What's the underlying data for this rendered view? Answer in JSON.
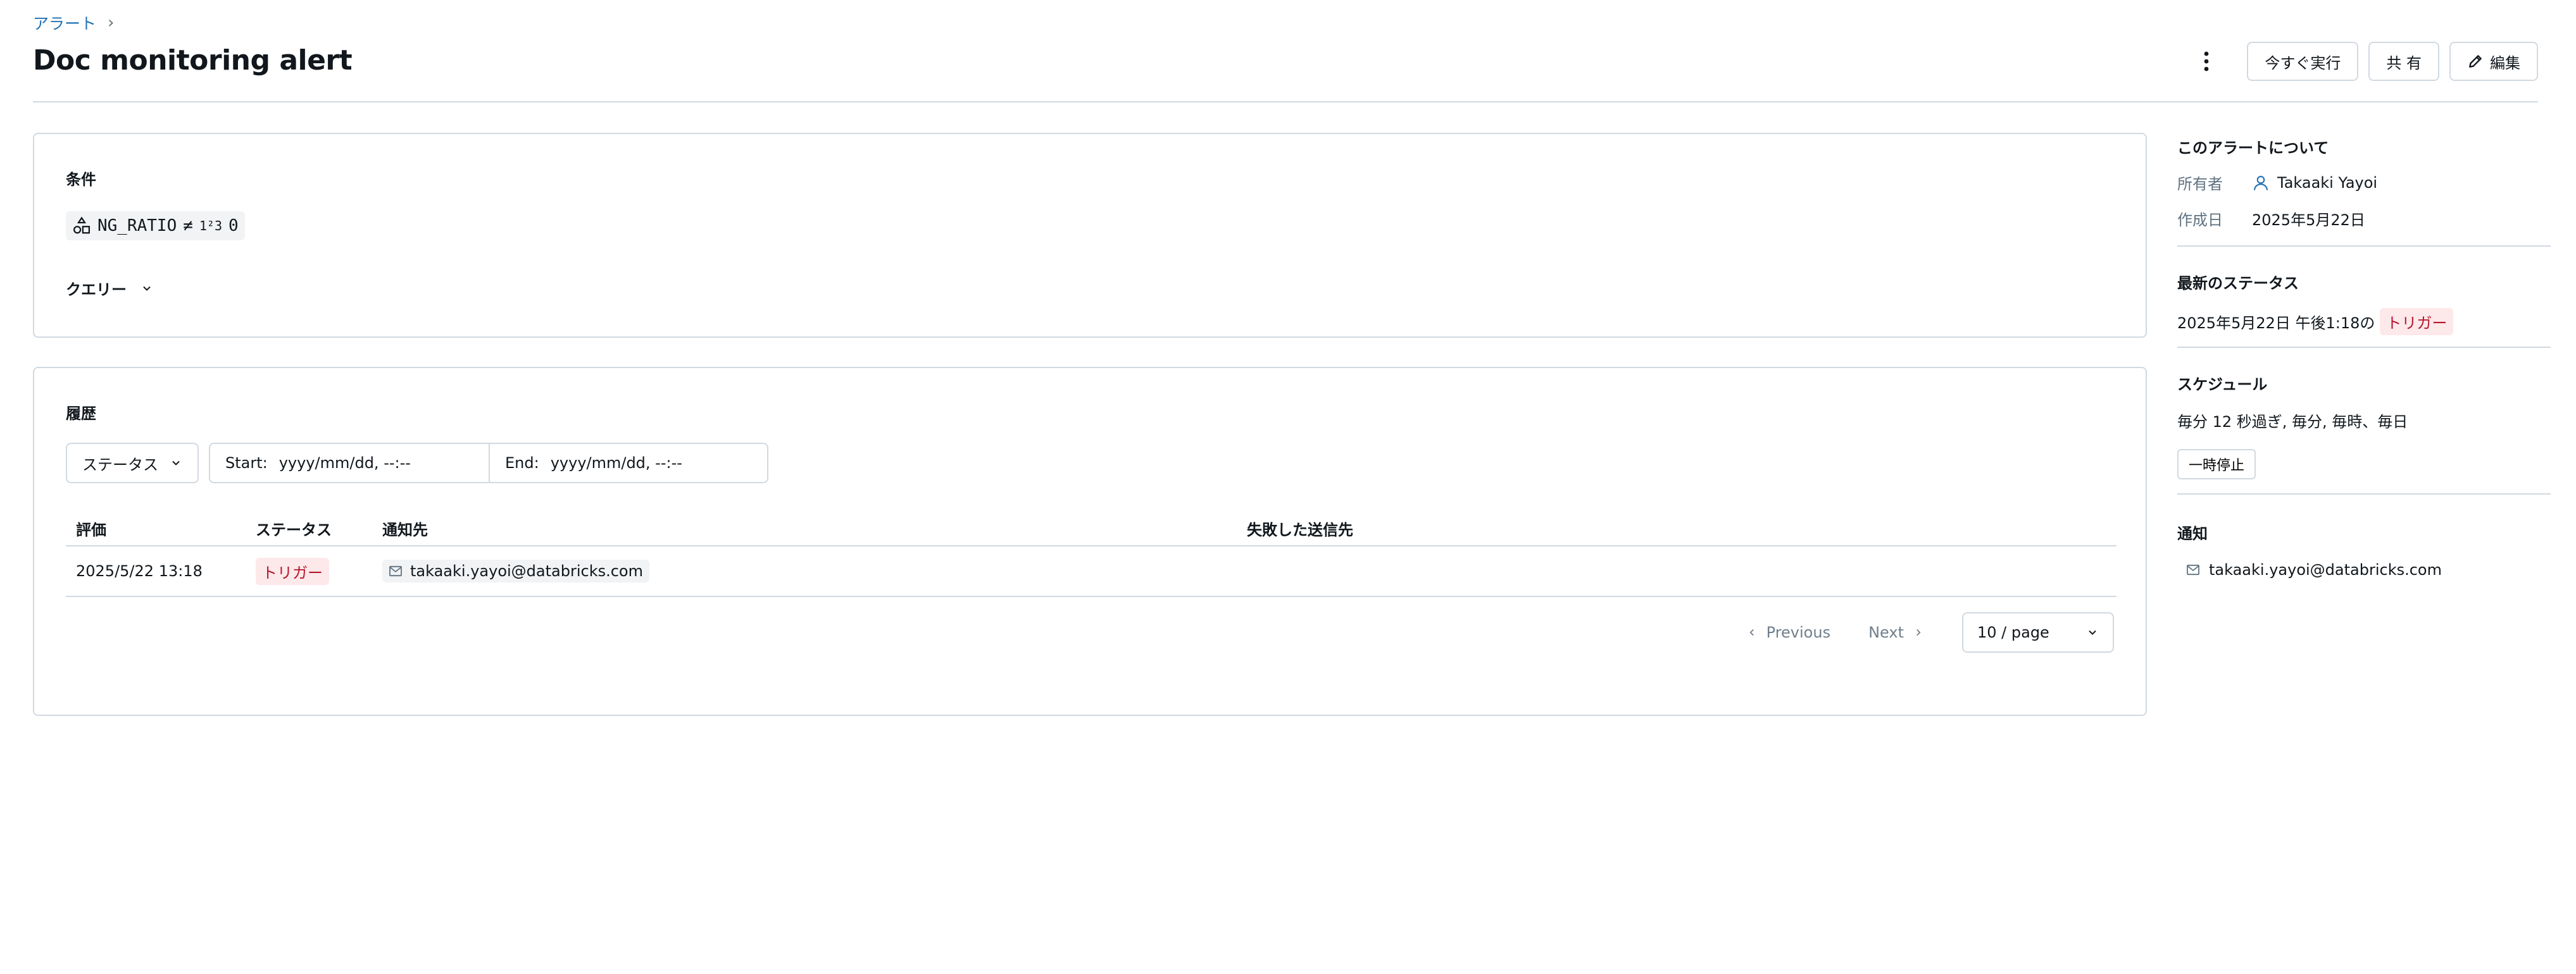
{
  "breadcrumb": {
    "parent": "アラート",
    "separator": "›"
  },
  "page": {
    "title": "Doc monitoring alert"
  },
  "header": {
    "run_now": "今すぐ実行",
    "share": "共 有",
    "edit": "編集"
  },
  "condition": {
    "title": "条件",
    "column": "NG_RATIO",
    "operator": "≠",
    "value_type": "1²3",
    "value": "0",
    "query_label": "クエリー"
  },
  "history": {
    "title": "履歴",
    "status_filter": "ステータス",
    "start_label": "Start:",
    "start_placeholder": "yyyy/mm/dd, --:--",
    "end_label": "End:",
    "end_placeholder": "yyyy/mm/dd, --:--",
    "columns": [
      "評価",
      "ステータス",
      "通知先",
      "失敗した送信先"
    ],
    "rows": [
      {
        "evaluated": "2025/5/22 13:18",
        "status": "トリガー",
        "recipient": "takaaki.yayoi@databricks.com",
        "failed": ""
      }
    ],
    "pagination": {
      "previous": "Previous",
      "next": "Next",
      "page_size": "10 / page"
    }
  },
  "sidebar": {
    "about_title": "このアラートについて",
    "owner_label": "所有者",
    "owner": "Takaaki Yayoi",
    "created_label": "作成日",
    "created": "2025年5月22日",
    "status_title": "最新のステータス",
    "status_time": "2025年5月22日 午後1:18の",
    "status_value": "トリガー",
    "schedule_title": "スケジュール",
    "schedule_text": "毎分 12 秒過ぎ, 毎分, 毎時、毎日",
    "pause_label": "一時停止",
    "notify_title": "通知",
    "notify_email": "takaaki.yayoi@databricks.com"
  },
  "colors": {
    "accent": "#2272b4",
    "border": "#d1d9e1",
    "trigger_bg": "#fde8ea",
    "trigger_text": "#b5162c"
  }
}
